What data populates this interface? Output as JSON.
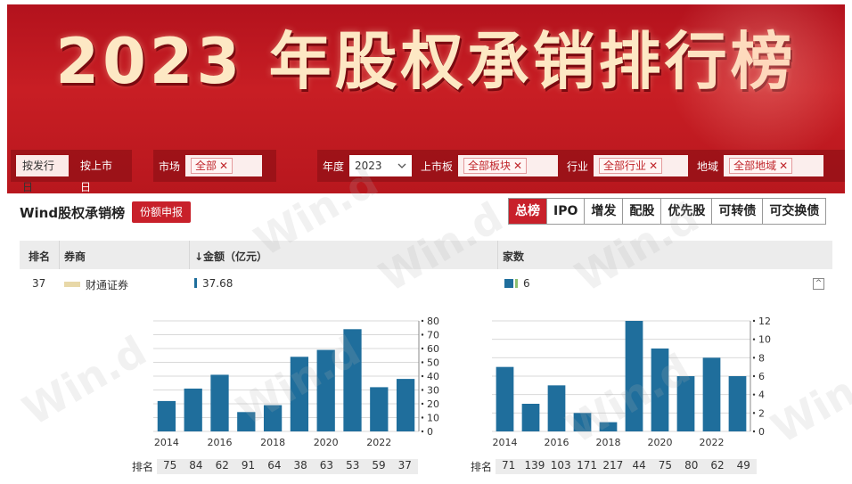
{
  "banner": {
    "title": "2023 年股权承销排行榜"
  },
  "filters": {
    "date_type": [
      "按发行日",
      "按上市日"
    ],
    "market_label": "市场",
    "market_tag": "全部",
    "year_label": "年度",
    "year_value": "2023",
    "board_label": "上市板",
    "board_tag": "全部板块",
    "industry_label": "行业",
    "industry_tag": "全部行业",
    "region_label": "地域",
    "region_tag": "全部地域",
    "remove_glyph": "✕"
  },
  "toolbar": {
    "title": "Wind股权承销榜",
    "share_button": "份额申报",
    "tabs": [
      "总榜",
      "IPO",
      "增发",
      "配股",
      "优先股",
      "可转债",
      "可交换债"
    ],
    "active_tab": "总榜"
  },
  "table": {
    "headers": {
      "rank": "排名",
      "broker": "券商",
      "amount": "↓金额（亿元）",
      "count": "家数"
    },
    "row": {
      "rank": "37",
      "broker": "财通证券",
      "amount": "37.68",
      "count": "6"
    }
  },
  "colors": {
    "bar": "#1f6e9c",
    "accent": "#c8202a"
  },
  "chart_data": [
    {
      "type": "bar",
      "x": [
        2014,
        2015,
        2016,
        2017,
        2018,
        2019,
        2020,
        2021,
        2022,
        2023
      ],
      "x_tick_labels": [
        "2014",
        "2016",
        "2018",
        "2020",
        "2022"
      ],
      "values": [
        22,
        31,
        41,
        14,
        19,
        54,
        59,
        74,
        32,
        38
      ],
      "ylim": [
        0,
        80
      ],
      "y_ticks": [
        0,
        10,
        20,
        30,
        40,
        50,
        60,
        70,
        80
      ],
      "y_axis_side": "right",
      "rank_label": "排名",
      "ranks": [
        "75",
        "84",
        "62",
        "91",
        "64",
        "38",
        "63",
        "53",
        "59",
        "37"
      ]
    },
    {
      "type": "bar",
      "x": [
        2014,
        2015,
        2016,
        2017,
        2018,
        2019,
        2020,
        2021,
        2022,
        2023
      ],
      "x_tick_labels": [
        "2014",
        "2016",
        "2018",
        "2020",
        "2022"
      ],
      "values": [
        7,
        3,
        5,
        2,
        1,
        12,
        9,
        6,
        8,
        6
      ],
      "ylim": [
        0,
        12
      ],
      "y_ticks": [
        0,
        2,
        4,
        6,
        8,
        10,
        12
      ],
      "y_axis_side": "right",
      "rank_label": "排名",
      "ranks": [
        "71",
        "139",
        "103",
        "171",
        "217",
        "44",
        "75",
        "80",
        "62",
        "49"
      ]
    }
  ]
}
